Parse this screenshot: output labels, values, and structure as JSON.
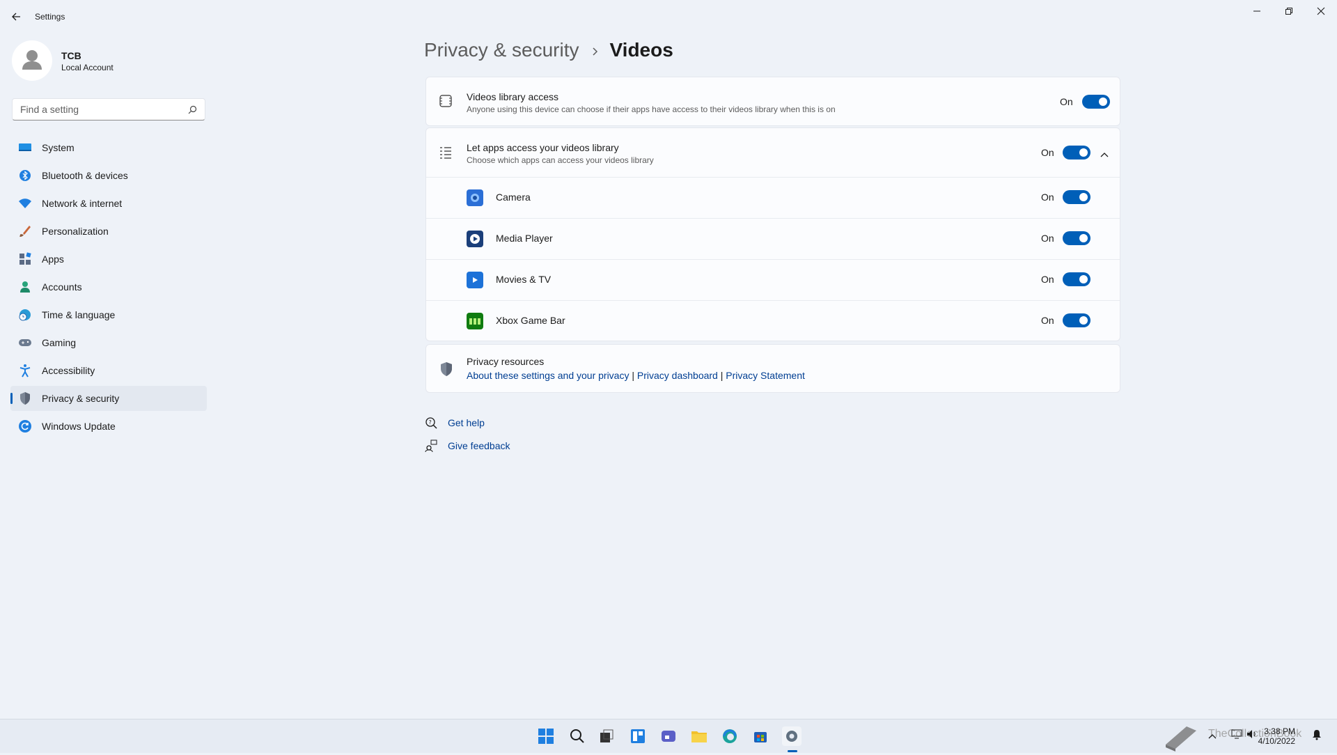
{
  "window": {
    "title": "Settings"
  },
  "profile": {
    "name": "TCB",
    "account_type": "Local Account"
  },
  "search": {
    "placeholder": "Find a setting"
  },
  "sidebar": {
    "items": [
      {
        "label": "System",
        "icon": "system-icon"
      },
      {
        "label": "Bluetooth & devices",
        "icon": "bluetooth-icon"
      },
      {
        "label": "Network & internet",
        "icon": "wifi-icon"
      },
      {
        "label": "Personalization",
        "icon": "brush-icon"
      },
      {
        "label": "Apps",
        "icon": "apps-icon"
      },
      {
        "label": "Accounts",
        "icon": "person-icon"
      },
      {
        "label": "Time & language",
        "icon": "globe-clock-icon"
      },
      {
        "label": "Gaming",
        "icon": "gamepad-icon"
      },
      {
        "label": "Accessibility",
        "icon": "accessibility-icon"
      },
      {
        "label": "Privacy & security",
        "icon": "shield-icon",
        "active": true
      },
      {
        "label": "Windows Update",
        "icon": "update-icon"
      }
    ]
  },
  "header": {
    "breadcrumb_parent": "Privacy & security",
    "separator": "›",
    "current": "Videos"
  },
  "library_access": {
    "title": "Videos library access",
    "description": "Anyone using this device can choose if their apps have access to their videos library when this is on",
    "state_label": "On",
    "enabled": true
  },
  "apps_access": {
    "title": "Let apps access your videos library",
    "description": "Choose which apps can access your videos library",
    "state_label": "On",
    "enabled": true,
    "expanded": true,
    "apps": [
      {
        "name": "Camera",
        "state_label": "On",
        "enabled": true,
        "icon": "camera-app-icon",
        "color": "#2b6fd6"
      },
      {
        "name": "Media Player",
        "state_label": "On",
        "enabled": true,
        "icon": "media-player-icon",
        "color": "#1b3f7a"
      },
      {
        "name": "Movies & TV",
        "state_label": "On",
        "enabled": true,
        "icon": "movies-tv-icon",
        "color": "#1d72d8"
      },
      {
        "name": "Xbox Game Bar",
        "state_label": "On",
        "enabled": true,
        "icon": "xbox-game-bar-icon",
        "color": "#107c10"
      }
    ]
  },
  "privacy_resources": {
    "title": "Privacy resources",
    "links": [
      "About these settings and your privacy",
      "Privacy dashboard",
      "Privacy Statement"
    ],
    "separator": "|"
  },
  "help_links": {
    "get_help": "Get help",
    "give_feedback": "Give feedback"
  },
  "taskbar": {
    "apps": [
      "start-icon",
      "search-icon",
      "task-view-icon",
      "widgets-icon",
      "chat-icon",
      "file-explorer-icon",
      "edge-icon",
      "store-icon",
      "settings-icon"
    ],
    "time": "3:38 PM",
    "date": "4/10/2022"
  },
  "watermark": "TheCollectionBook",
  "colors": {
    "accent": "#005fb8",
    "background": "#eef2f8",
    "card": "#fbfcfe",
    "link": "#003e92"
  }
}
